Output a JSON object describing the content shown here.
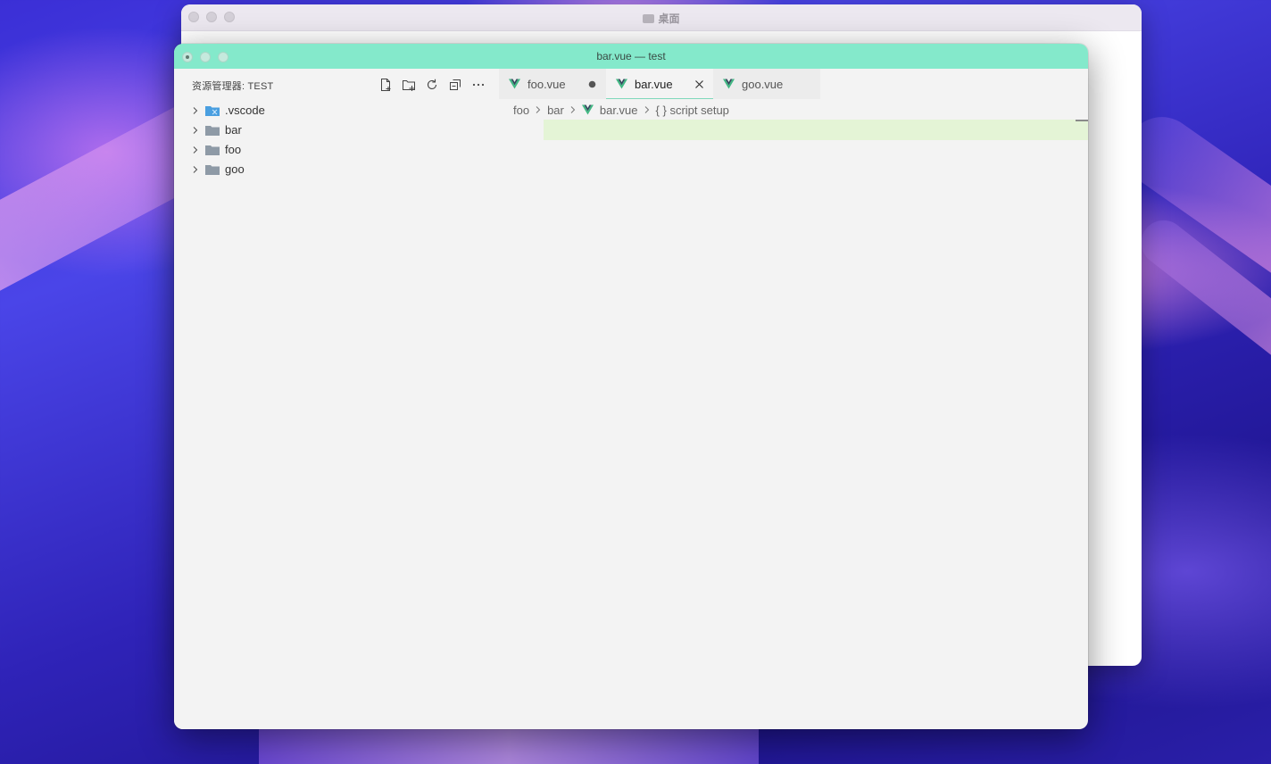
{
  "finder": {
    "title": "桌面"
  },
  "vscode": {
    "window_title": "bar.vue — test",
    "explorer_title": "资源管理器: TEST",
    "explorer_actions": [
      "new-file-icon",
      "new-folder-icon",
      "refresh-icon",
      "collapse-all-icon",
      "more-icon"
    ],
    "tree": [
      {
        "label": ".vscode",
        "icon": "vscode-folder-icon"
      },
      {
        "label": "bar",
        "icon": "folder-icon"
      },
      {
        "label": "foo",
        "icon": "folder-icon"
      },
      {
        "label": "goo",
        "icon": "folder-icon"
      }
    ],
    "tabs": [
      {
        "label": "foo.vue",
        "state": "modified"
      },
      {
        "label": "bar.vue",
        "state": "active"
      },
      {
        "label": "goo.vue",
        "state": "normal"
      }
    ],
    "breadcrumb": {
      "part1": "foo",
      "part2": "bar",
      "part3": "bar.vue",
      "part4": "{ } script setup"
    },
    "colors": {
      "titlebar": "#84e9cb",
      "vue_green": "#41b883",
      "vue_dark": "#35495e",
      "line_highlight": "#e4f4d6"
    }
  }
}
